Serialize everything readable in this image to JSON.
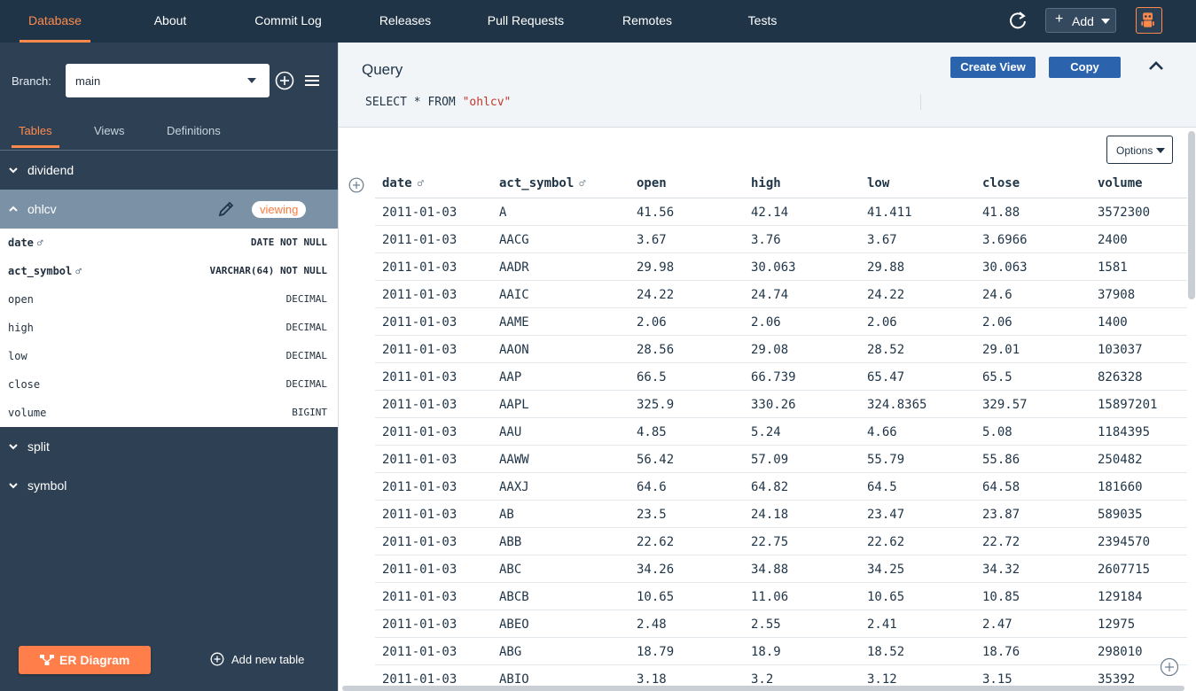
{
  "nav": {
    "tabs": [
      "Database",
      "About",
      "Commit Log",
      "Releases",
      "Pull Requests",
      "Remotes",
      "Tests"
    ],
    "add_label": "Add"
  },
  "sidebar": {
    "branch_label": "Branch:",
    "branch_value": "main",
    "tabs": [
      "Tables",
      "Views",
      "Definitions"
    ],
    "tables": [
      "dividend",
      "ohlcv",
      "split",
      "symbol"
    ],
    "viewing_badge": "viewing",
    "columns": [
      {
        "name": "date",
        "type": "DATE NOT NULL",
        "pk": true
      },
      {
        "name": "act_symbol",
        "type": "VARCHAR(64) NOT NULL",
        "pk": true
      },
      {
        "name": "open",
        "type": "DECIMAL",
        "pk": false
      },
      {
        "name": "high",
        "type": "DECIMAL",
        "pk": false
      },
      {
        "name": "low",
        "type": "DECIMAL",
        "pk": false
      },
      {
        "name": "close",
        "type": "DECIMAL",
        "pk": false
      },
      {
        "name": "volume",
        "type": "BIGINT",
        "pk": false
      }
    ],
    "er_diagram_label": "ER Diagram",
    "add_table_label": "Add new table"
  },
  "query": {
    "title": "Query",
    "create_view_label": "Create View",
    "copy_label": "Copy",
    "sql_prefix": "SELECT * FROM ",
    "sql_table": "\"ohlcv\""
  },
  "table": {
    "options_label": "Options",
    "headers": [
      "date",
      "act_symbol",
      "open",
      "high",
      "low",
      "close",
      "volume"
    ],
    "rows": [
      [
        "2011-01-03",
        "A",
        "41.56",
        "42.14",
        "41.411",
        "41.88",
        "3572300"
      ],
      [
        "2011-01-03",
        "AACG",
        "3.67",
        "3.76",
        "3.67",
        "3.6966",
        "2400"
      ],
      [
        "2011-01-03",
        "AADR",
        "29.98",
        "30.063",
        "29.88",
        "30.063",
        "1581"
      ],
      [
        "2011-01-03",
        "AAIC",
        "24.22",
        "24.74",
        "24.22",
        "24.6",
        "37908"
      ],
      [
        "2011-01-03",
        "AAME",
        "2.06",
        "2.06",
        "2.06",
        "2.06",
        "1400"
      ],
      [
        "2011-01-03",
        "AAON",
        "28.56",
        "29.08",
        "28.52",
        "29.01",
        "103037"
      ],
      [
        "2011-01-03",
        "AAP",
        "66.5",
        "66.739",
        "65.47",
        "65.5",
        "826328"
      ],
      [
        "2011-01-03",
        "AAPL",
        "325.9",
        "330.26",
        "324.8365",
        "329.57",
        "15897201"
      ],
      [
        "2011-01-03",
        "AAU",
        "4.85",
        "5.24",
        "4.66",
        "5.08",
        "1184395"
      ],
      [
        "2011-01-03",
        "AAWW",
        "56.42",
        "57.09",
        "55.79",
        "55.86",
        "250482"
      ],
      [
        "2011-01-03",
        "AAXJ",
        "64.6",
        "64.82",
        "64.5",
        "64.58",
        "181660"
      ],
      [
        "2011-01-03",
        "AB",
        "23.5",
        "24.18",
        "23.47",
        "23.87",
        "589035"
      ],
      [
        "2011-01-03",
        "ABB",
        "22.62",
        "22.75",
        "22.62",
        "22.72",
        "2394570"
      ],
      [
        "2011-01-03",
        "ABC",
        "34.26",
        "34.88",
        "34.25",
        "34.32",
        "2607715"
      ],
      [
        "2011-01-03",
        "ABCB",
        "10.65",
        "11.06",
        "10.65",
        "10.85",
        "129184"
      ],
      [
        "2011-01-03",
        "ABEO",
        "2.48",
        "2.55",
        "2.41",
        "2.47",
        "12975"
      ],
      [
        "2011-01-03",
        "ABG",
        "18.79",
        "18.9",
        "18.52",
        "18.76",
        "298010"
      ],
      [
        "2011-01-03",
        "ABIO",
        "3.18",
        "3.2",
        "3.12",
        "3.15",
        "35392"
      ]
    ]
  },
  "colors": {
    "accent": "#ff8a4c",
    "nav_bg": "#1f3447",
    "sidebar_bg": "#2e4154",
    "button_blue": "#2b63ad"
  }
}
